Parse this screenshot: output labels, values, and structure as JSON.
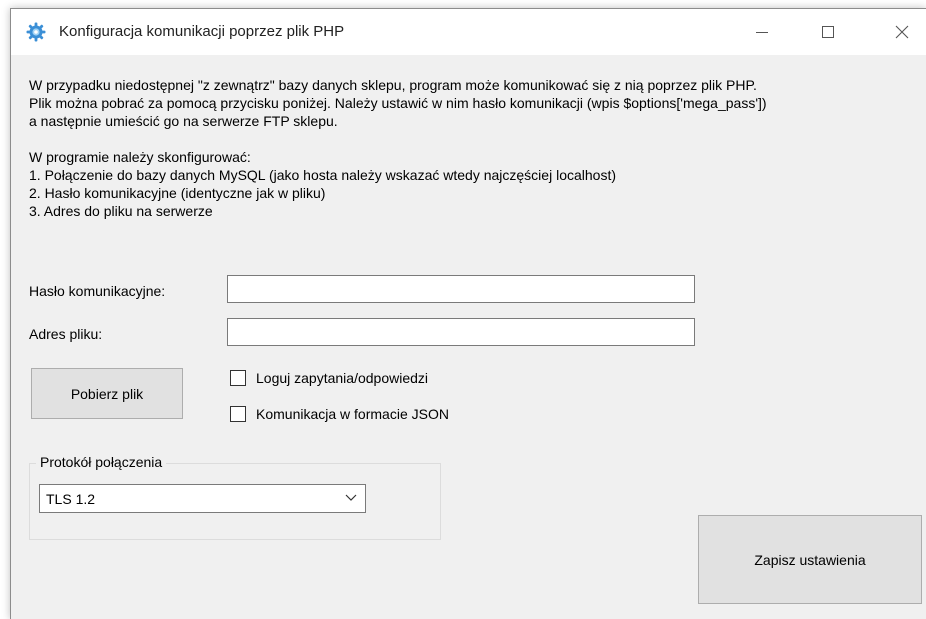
{
  "window": {
    "title": "Konfiguracja komunikacji poprzez plik PHP",
    "icon": "gear-icon"
  },
  "info": {
    "lines": [
      "W przypadku niedostępnej \"z zewnątrz\" bazy danych sklepu, program może komunikować się z nią poprzez plik PHP.",
      "Plik można pobrać za pomocą przycisku poniżej. Należy ustawić w nim hasło komunikacji (wpis $options['mega_pass'])",
      "a następnie umieścić go na serwerze FTP sklepu.",
      "",
      "W programie należy skonfigurować:",
      "1. Połączenie do bazy danych MySQL (jako hosta należy wskazać wtedy najczęściej localhost)",
      "2. Hasło komunikacyjne (identyczne jak w pliku)",
      "3. Adres do pliku na serwerze"
    ]
  },
  "form": {
    "password_label": "Hasło komunikacyjne:",
    "password_value": "",
    "address_label": "Adres pliku:",
    "address_value": ""
  },
  "buttons": {
    "download": "Pobierz plik",
    "save": "Zapisz ustawienia"
  },
  "checkboxes": {
    "log_label": "Loguj zapytania/odpowiedzi",
    "log_checked": false,
    "json_label": "Komunikacja w formacie JSON",
    "json_checked": false
  },
  "protocol": {
    "group_title": "Protokół połączenia",
    "selected": "TLS 1.2"
  },
  "colors": {
    "window_bg": "#f0f0f0",
    "titlebar_bg": "#ffffff",
    "button_bg": "#e1e1e1",
    "icon_accent": "#3b8fd6"
  }
}
